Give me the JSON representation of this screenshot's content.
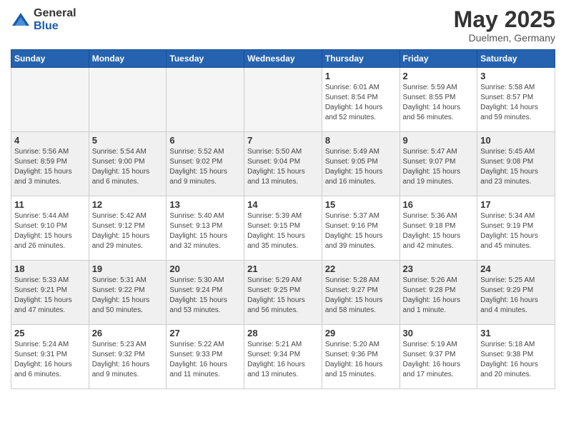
{
  "header": {
    "logo_general": "General",
    "logo_blue": "Blue",
    "month": "May 2025",
    "location": "Duelmen, Germany"
  },
  "weekdays": [
    "Sunday",
    "Monday",
    "Tuesday",
    "Wednesday",
    "Thursday",
    "Friday",
    "Saturday"
  ],
  "weeks": [
    [
      {
        "day": "",
        "info": "",
        "empty": true
      },
      {
        "day": "",
        "info": "",
        "empty": true
      },
      {
        "day": "",
        "info": "",
        "empty": true
      },
      {
        "day": "",
        "info": "",
        "empty": true
      },
      {
        "day": "1",
        "info": "Sunrise: 6:01 AM\nSunset: 8:54 PM\nDaylight: 14 hours\nand 52 minutes.",
        "empty": false
      },
      {
        "day": "2",
        "info": "Sunrise: 5:59 AM\nSunset: 8:55 PM\nDaylight: 14 hours\nand 56 minutes.",
        "empty": false
      },
      {
        "day": "3",
        "info": "Sunrise: 5:58 AM\nSunset: 8:57 PM\nDaylight: 14 hours\nand 59 minutes.",
        "empty": false
      }
    ],
    [
      {
        "day": "4",
        "info": "Sunrise: 5:56 AM\nSunset: 8:59 PM\nDaylight: 15 hours\nand 3 minutes.",
        "empty": false
      },
      {
        "day": "5",
        "info": "Sunrise: 5:54 AM\nSunset: 9:00 PM\nDaylight: 15 hours\nand 6 minutes.",
        "empty": false
      },
      {
        "day": "6",
        "info": "Sunrise: 5:52 AM\nSunset: 9:02 PM\nDaylight: 15 hours\nand 9 minutes.",
        "empty": false
      },
      {
        "day": "7",
        "info": "Sunrise: 5:50 AM\nSunset: 9:04 PM\nDaylight: 15 hours\nand 13 minutes.",
        "empty": false
      },
      {
        "day": "8",
        "info": "Sunrise: 5:49 AM\nSunset: 9:05 PM\nDaylight: 15 hours\nand 16 minutes.",
        "empty": false
      },
      {
        "day": "9",
        "info": "Sunrise: 5:47 AM\nSunset: 9:07 PM\nDaylight: 15 hours\nand 19 minutes.",
        "empty": false
      },
      {
        "day": "10",
        "info": "Sunrise: 5:45 AM\nSunset: 9:08 PM\nDaylight: 15 hours\nand 23 minutes.",
        "empty": false
      }
    ],
    [
      {
        "day": "11",
        "info": "Sunrise: 5:44 AM\nSunset: 9:10 PM\nDaylight: 15 hours\nand 26 minutes.",
        "empty": false
      },
      {
        "day": "12",
        "info": "Sunrise: 5:42 AM\nSunset: 9:12 PM\nDaylight: 15 hours\nand 29 minutes.",
        "empty": false
      },
      {
        "day": "13",
        "info": "Sunrise: 5:40 AM\nSunset: 9:13 PM\nDaylight: 15 hours\nand 32 minutes.",
        "empty": false
      },
      {
        "day": "14",
        "info": "Sunrise: 5:39 AM\nSunset: 9:15 PM\nDaylight: 15 hours\nand 35 minutes.",
        "empty": false
      },
      {
        "day": "15",
        "info": "Sunrise: 5:37 AM\nSunset: 9:16 PM\nDaylight: 15 hours\nand 39 minutes.",
        "empty": false
      },
      {
        "day": "16",
        "info": "Sunrise: 5:36 AM\nSunset: 9:18 PM\nDaylight: 15 hours\nand 42 minutes.",
        "empty": false
      },
      {
        "day": "17",
        "info": "Sunrise: 5:34 AM\nSunset: 9:19 PM\nDaylight: 15 hours\nand 45 minutes.",
        "empty": false
      }
    ],
    [
      {
        "day": "18",
        "info": "Sunrise: 5:33 AM\nSunset: 9:21 PM\nDaylight: 15 hours\nand 47 minutes.",
        "empty": false
      },
      {
        "day": "19",
        "info": "Sunrise: 5:31 AM\nSunset: 9:22 PM\nDaylight: 15 hours\nand 50 minutes.",
        "empty": false
      },
      {
        "day": "20",
        "info": "Sunrise: 5:30 AM\nSunset: 9:24 PM\nDaylight: 15 hours\nand 53 minutes.",
        "empty": false
      },
      {
        "day": "21",
        "info": "Sunrise: 5:29 AM\nSunset: 9:25 PM\nDaylight: 15 hours\nand 56 minutes.",
        "empty": false
      },
      {
        "day": "22",
        "info": "Sunrise: 5:28 AM\nSunset: 9:27 PM\nDaylight: 15 hours\nand 58 minutes.",
        "empty": false
      },
      {
        "day": "23",
        "info": "Sunrise: 5:26 AM\nSunset: 9:28 PM\nDaylight: 16 hours\nand 1 minute.",
        "empty": false
      },
      {
        "day": "24",
        "info": "Sunrise: 5:25 AM\nSunset: 9:29 PM\nDaylight: 16 hours\nand 4 minutes.",
        "empty": false
      }
    ],
    [
      {
        "day": "25",
        "info": "Sunrise: 5:24 AM\nSunset: 9:31 PM\nDaylight: 16 hours\nand 6 minutes.",
        "empty": false
      },
      {
        "day": "26",
        "info": "Sunrise: 5:23 AM\nSunset: 9:32 PM\nDaylight: 16 hours\nand 9 minutes.",
        "empty": false
      },
      {
        "day": "27",
        "info": "Sunrise: 5:22 AM\nSunset: 9:33 PM\nDaylight: 16 hours\nand 11 minutes.",
        "empty": false
      },
      {
        "day": "28",
        "info": "Sunrise: 5:21 AM\nSunset: 9:34 PM\nDaylight: 16 hours\nand 13 minutes.",
        "empty": false
      },
      {
        "day": "29",
        "info": "Sunrise: 5:20 AM\nSunset: 9:36 PM\nDaylight: 16 hours\nand 15 minutes.",
        "empty": false
      },
      {
        "day": "30",
        "info": "Sunrise: 5:19 AM\nSunset: 9:37 PM\nDaylight: 16 hours\nand 17 minutes.",
        "empty": false
      },
      {
        "day": "31",
        "info": "Sunrise: 5:18 AM\nSunset: 9:38 PM\nDaylight: 16 hours\nand 20 minutes.",
        "empty": false
      }
    ]
  ]
}
